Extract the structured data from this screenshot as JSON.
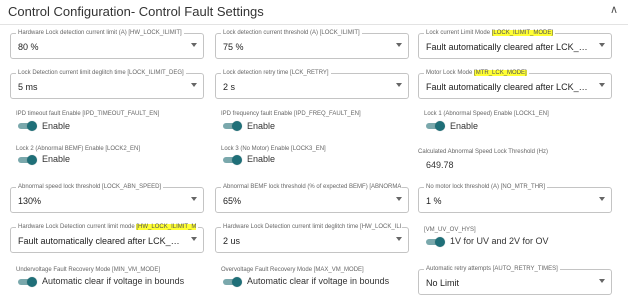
{
  "header": {
    "title": "Control Configuration- Control Fault Settings"
  },
  "row1": {
    "hw_lock_ilimit": {
      "label": "Hardware Lock detection current limit (A) [HW_LOCK_ILIMIT]",
      "value": "80 %"
    },
    "lock_ilimit": {
      "label": "Lock detection current threshold (A) [LOCK_ILIMIT]",
      "value": "75 %"
    },
    "lock_ilimit_mode": {
      "label_prefix": "Lock current Limit Mode ",
      "label_hl": "[LOCK_ILIMIT_MODE]",
      "value": "Fault automatically cleared after LCK_RETRY t..."
    }
  },
  "row2": {
    "lock_ilimit_deg": {
      "label": "Lock Detection current limit deglitch time [LOCK_ILIMIT_DEG]",
      "value": "5 ms"
    },
    "lck_retry": {
      "label": "Lock detection retry time [LCK_RETRY]",
      "value": "2 s"
    },
    "mtr_lck_mode": {
      "label_prefix": "Motor Lock Mode ",
      "label_hl": "[MTR_LCK_MODE]",
      "value": "Fault automatically cleared after LCK_RETRY t..."
    }
  },
  "row3": {
    "ipd_timeout": {
      "label": "IPD timeout fault Enable [IPD_TIMEOUT_FAULT_EN]",
      "text": "Enable"
    },
    "ipd_freq": {
      "label": "IPD frequency fault Enable [IPD_FREQ_FAULT_EN]",
      "text": "Enable"
    },
    "lock1": {
      "label": "Lock 1 (Abnormal Speed) Enable [LOCK1_EN]",
      "text": "Enable"
    }
  },
  "row4": {
    "lock2": {
      "label": "Lock 2 (Abnormal BEMF) Enable [LOCK2_EN]",
      "text": "Enable"
    },
    "lock3": {
      "label": "Lock 3 (No Motor) Enable [LOCK3_EN]",
      "text": "Enable"
    },
    "abn_speed_calc": {
      "label": "Calculated Abnormal Speed Lock Threshold (Hz)",
      "value": "649.78"
    }
  },
  "row5": {
    "lock_abn_speed": {
      "label": "Abnormal speed lock threshold [LOCK_ABN_SPEED]",
      "value": "130%"
    },
    "abnormal_bemf": {
      "label": "Abnormal BEMF lock threshold (% of expected BEMF) [ABNORMA...",
      "value": "65%"
    },
    "no_mtr_thr": {
      "label": "No motor lock threshold (A) [NO_MTR_THR]",
      "value": "1 %"
    }
  },
  "row6": {
    "hw_lock_ilimit_mode": {
      "label_prefix": "Hardware Lock Detection current limit mode ",
      "label_hl": "[HW_LOCK_ILIMIT_M",
      "value": "Fault automatically cleared after LCK_RETRY t..."
    },
    "hw_lock_ilimit_deg": {
      "label": "Hardware Lock Detection current limit deglitch time [HW_LOCK_ILI...",
      "value": "2 us"
    },
    "vm_uv_ov_hys": {
      "label": "[VM_UV_OV_HYS]",
      "text": "1V for UV and 2V for OV"
    }
  },
  "row7": {
    "min_vm_mode": {
      "label": "Undervoltage Fault Recovery Mode [MIN_VM_MODE]",
      "text": "Automatic clear if voltage in bounds"
    },
    "max_vm_mode": {
      "label": "Overvoltage Fault Recovery Mode [MAX_VM_MODE]",
      "text": "Automatic clear if voltage in bounds"
    },
    "auto_retry_times": {
      "label": "Automatic retry attempts [AUTO_RETRY_TIMES]",
      "value": "No Limit"
    }
  },
  "colors": {
    "accent": "#1f6f78",
    "highlight": "#ffff33",
    "border": "#c4c4c4"
  },
  "icons": {
    "collapse": "chevron-up-icon",
    "dropdown": "caret-down-icon"
  }
}
